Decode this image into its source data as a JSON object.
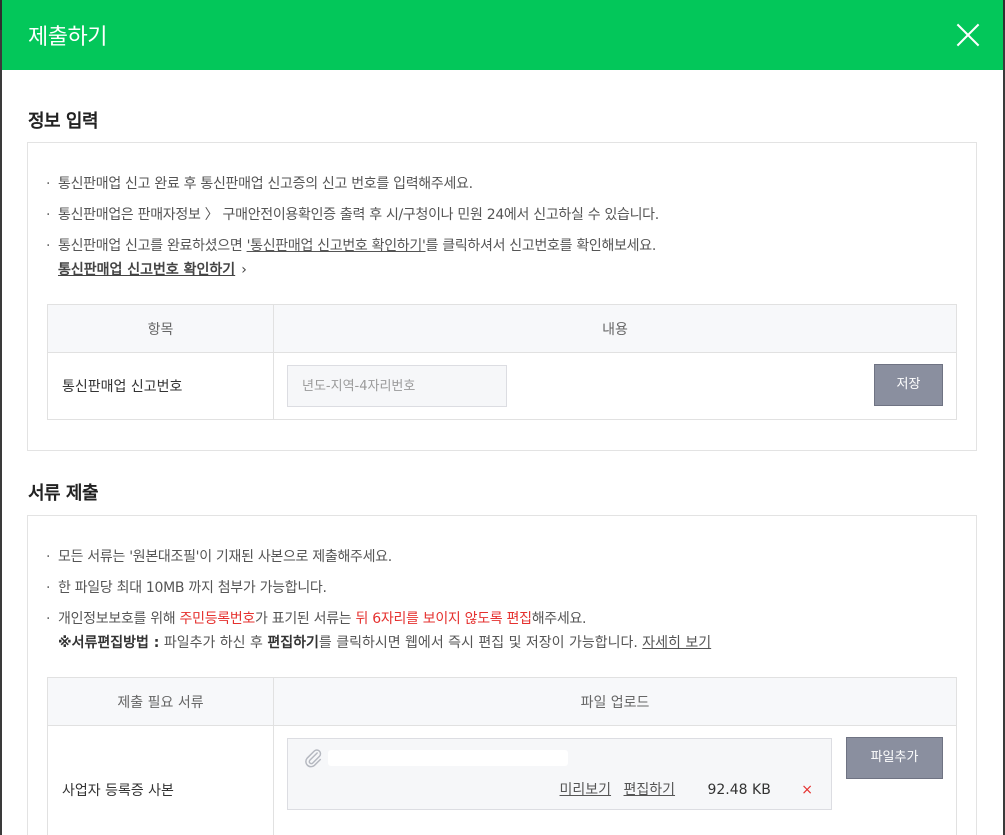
{
  "modal": {
    "title": "제출하기"
  },
  "info_section": {
    "title": "정보 입력",
    "notes": {
      "n1": "통신판매업 신고 완료 후 통신판매업 신고증의 신고 번호를 입력해주세요.",
      "n2": "통신판매업은 판매자정보 〉 구매안전이용확인증 출력 후 시/구청이나 민원 24에서 신고하실 수 있습니다.",
      "n3_pre": "통신판매업 신고를 완료하셨으면 ",
      "n3_link": "'통신판매업 신고번호 확인하기'",
      "n3_post": "를 클릭하셔서 신고번호를 확인해보세요.",
      "confirm_link": "통신판매업 신고번호 확인하기"
    },
    "table": {
      "header_item": "항목",
      "header_content": "내용",
      "row_label": "통신판매업 신고번호",
      "input_placeholder": "년도-지역-4자리번호",
      "save_button": "저장"
    }
  },
  "docs_section": {
    "title": "서류 제출",
    "notes": {
      "n1": "모든 서류는 '원본대조필'이 기재된 사본으로 제출해주세요.",
      "n2": "한 파일당 최대 10MB 까지 첨부가 가능합니다.",
      "n3_pre": "개인정보보호를 위해 ",
      "n3_red1": "주민등록번호",
      "n3_mid": "가 표기된 서류는 ",
      "n3_red2": "뒤 6자리를 보이지 않도록 편집",
      "n3_post": "해주세요.",
      "method_label": "※서류편집방법 :",
      "method_pre": " 파일추가 하신 후 ",
      "method_bold": "편집하기",
      "method_post": "를 클릭하시면 웹에서 즉시 편집 및 저장이 가능합니다. ",
      "detail_link": "자세히 보기"
    },
    "table": {
      "header_doc": "제출 필요 서류",
      "header_upload": "파일 업로드",
      "row_label": "사업자 등록증 사본",
      "preview_link": "미리보기",
      "edit_link": "편집하기",
      "file_size": "92.48 KB",
      "delete_icon": "×",
      "add_file_button": "파일추가"
    }
  },
  "colors": {
    "header": "#03c75a",
    "warning": "#e5312f",
    "button": "#8a8f9f"
  }
}
